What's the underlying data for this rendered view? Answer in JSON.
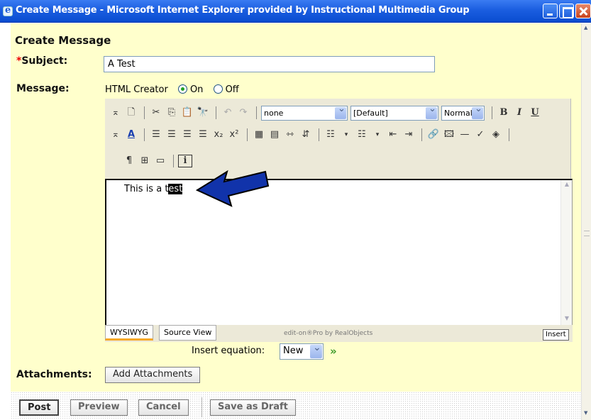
{
  "window": {
    "title": "Create Message - Microsoft Internet Explorer provided by Instructional Multimedia Group"
  },
  "page": {
    "title": "Create Message"
  },
  "subject": {
    "required_mark": "*",
    "label": "Subject:",
    "value": "A Test"
  },
  "message": {
    "label": "Message:",
    "html_creator_label": "HTML Creator",
    "on_label": "On",
    "off_label": "Off",
    "html_creator_state": "On"
  },
  "toolbar": {
    "style_select": "none",
    "font_select": "[Default]",
    "size_select": "Normal",
    "bold": "B",
    "italic": "I",
    "underline": "U",
    "color_glyph": "A"
  },
  "editor": {
    "text_before": "This is a t",
    "text_selected": "est",
    "tab_wysiwyg": "WYSIWYG",
    "tab_source": "Source View",
    "credit": "edit-on®Pro by RealObjects",
    "mode_indicator": "Insert"
  },
  "equation": {
    "label": "Insert equation:",
    "selected": "New"
  },
  "attachments": {
    "label": "Attachments:",
    "button": "Add Attachments"
  },
  "actions": {
    "post": "Post",
    "preview": "Preview",
    "cancel": "Cancel",
    "save_draft": "Save as Draft"
  },
  "colors": {
    "content_bg": "#ffffcc",
    "titlebar": "#1b5ee0",
    "arrow": "#1133aa",
    "required": "#ee0000"
  }
}
